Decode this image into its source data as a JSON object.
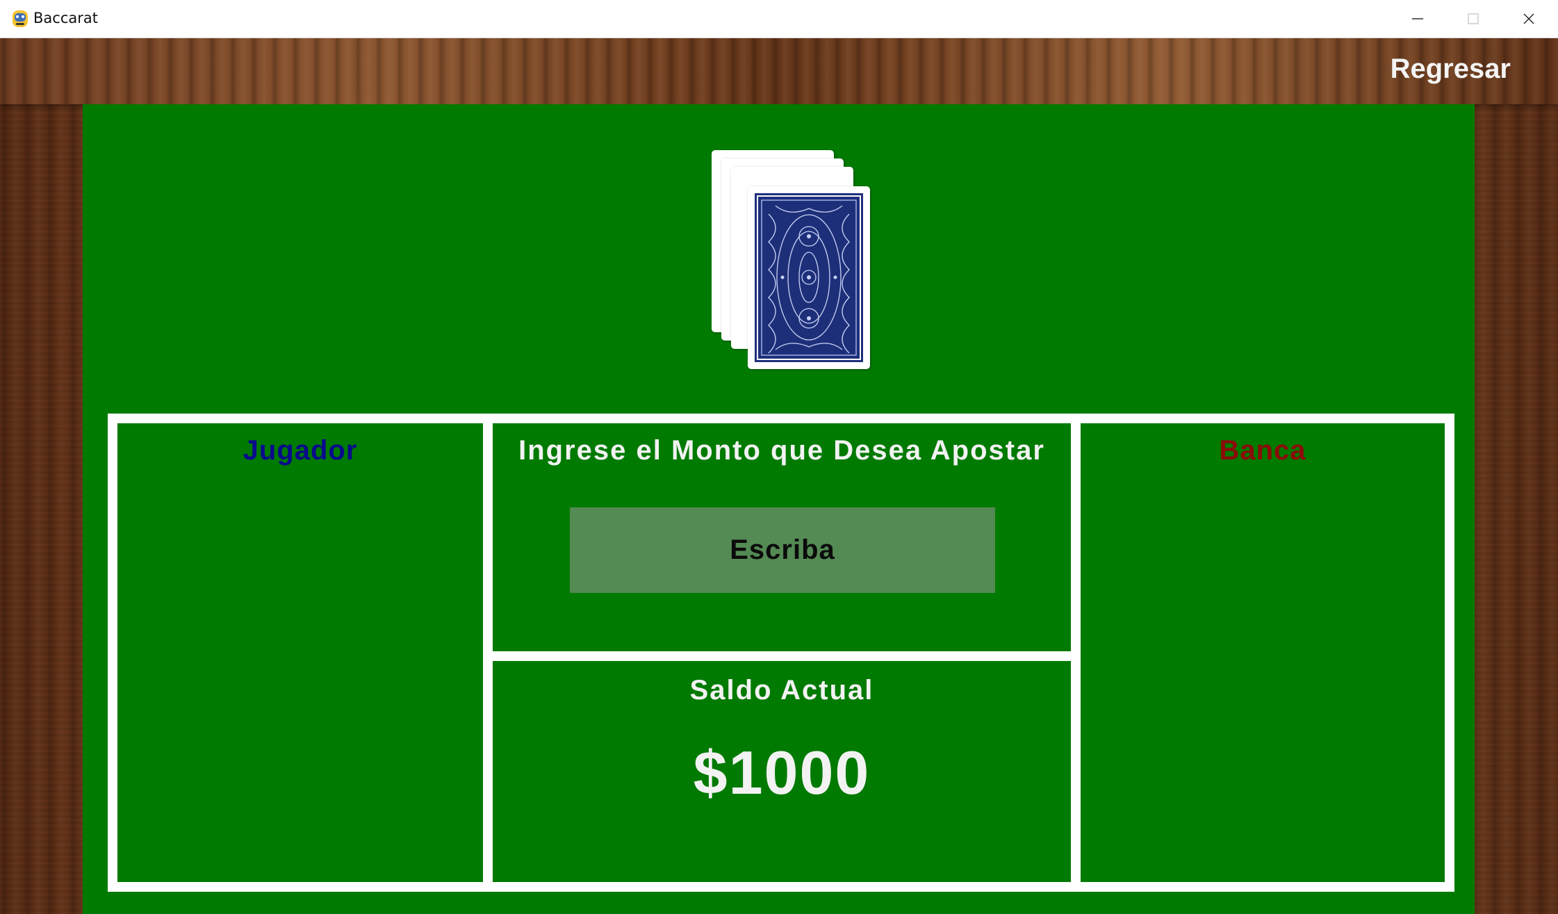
{
  "window": {
    "title": "Baccarat",
    "controls": [
      "minimize",
      "maximize",
      "close"
    ]
  },
  "header": {
    "back_label": "Regresar"
  },
  "deck": {
    "card_count_visible": 4,
    "card_back_color": "#1e2f7a"
  },
  "player_panel": {
    "title": "Jugador",
    "color": "#0a0a8c"
  },
  "bet_panel": {
    "title": "Ingrese el Monto que Desea Apostar",
    "input_placeholder": "Escriba",
    "input_value": ""
  },
  "balance_panel": {
    "title": "Saldo Actual",
    "value": "$1000"
  },
  "bank_panel": {
    "title": "Banca",
    "color": "#8c0a0a"
  },
  "colors": {
    "felt": "#007a00",
    "input_bg": "#548a54",
    "wood": "#6b3a1f"
  }
}
